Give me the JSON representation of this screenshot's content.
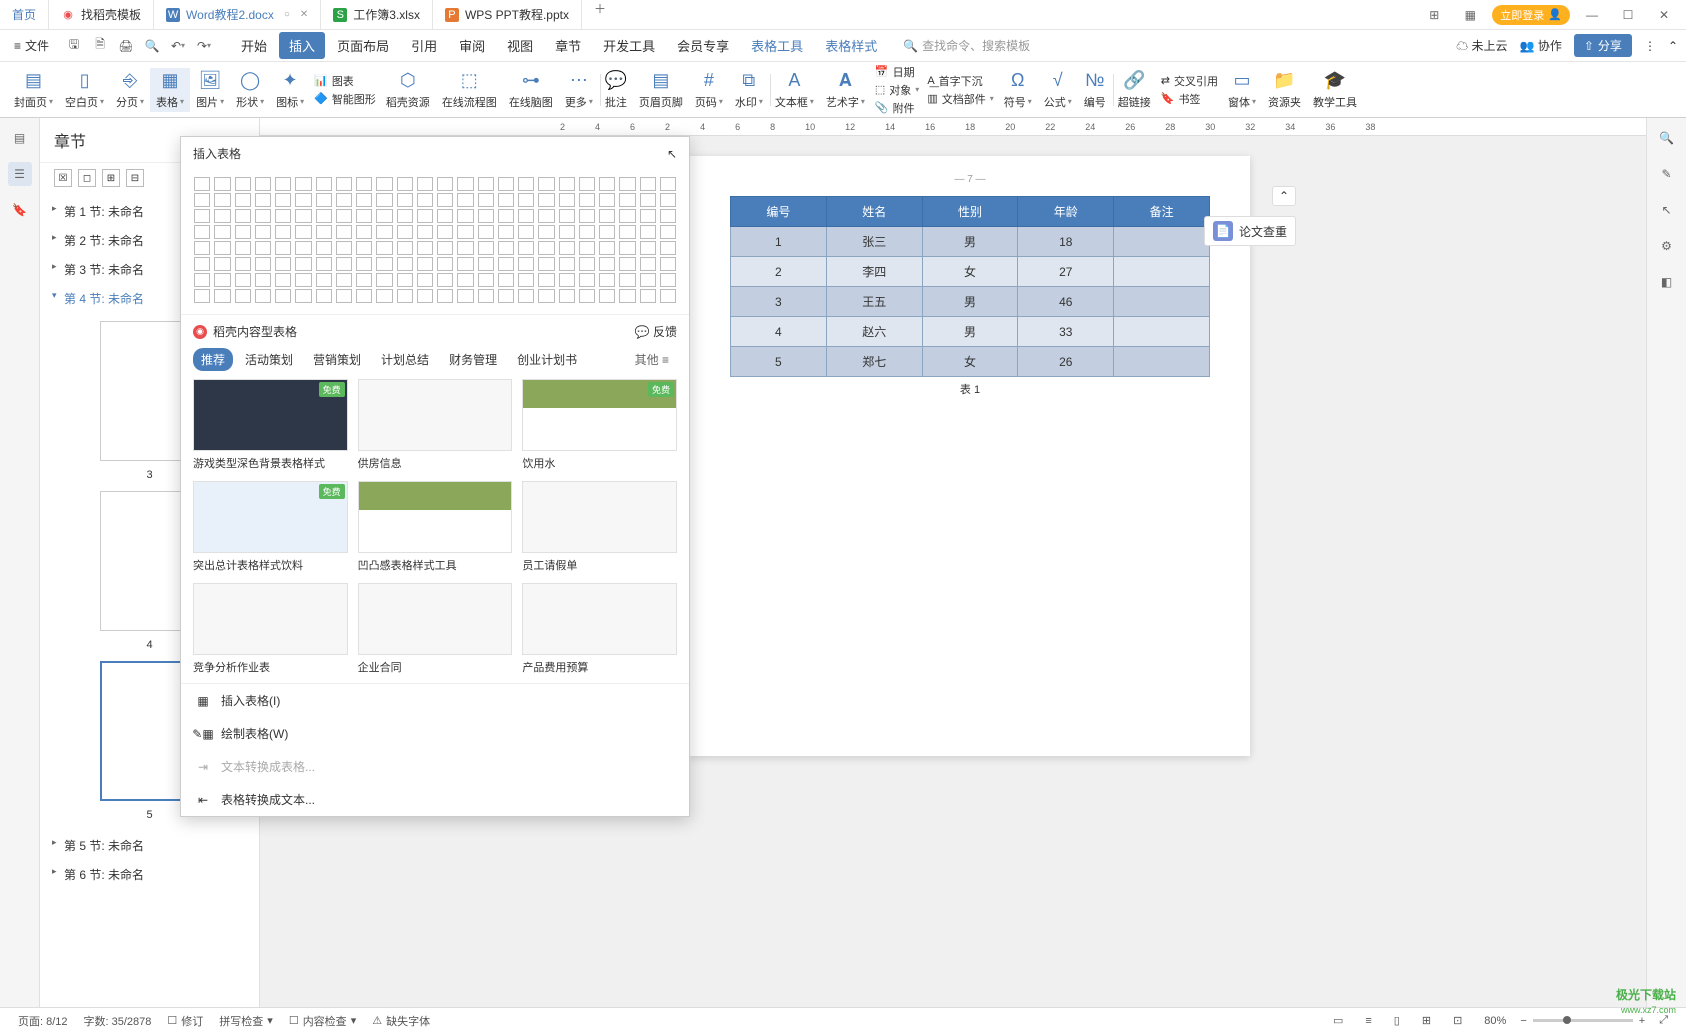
{
  "tabs": {
    "home": "首页",
    "t1": "找稻壳模板",
    "t2": "Word教程2.docx",
    "t3": "工作簿3.xlsx",
    "t4": "WPS PPT教程.pptx"
  },
  "titlebar": {
    "login": "立即登录"
  },
  "menubar": {
    "file": "文件",
    "tabs": [
      "开始",
      "插入",
      "页面布局",
      "引用",
      "审阅",
      "视图",
      "章节",
      "开发工具",
      "会员专享",
      "表格工具",
      "表格样式"
    ],
    "search_ph": "查找命令、搜索模板",
    "cloud": "未上云",
    "collab": "协作",
    "share": "分享"
  },
  "ribbon": {
    "cover": "封面页",
    "blank": "空白页",
    "pagebreak": "分页",
    "table": "表格",
    "pic": "图片",
    "shape": "形状",
    "icon": "图标",
    "chart": "图表",
    "smart": "智能图形",
    "docer": "稻壳资源",
    "flow": "在线流程图",
    "mind": "在线脑图",
    "more": "更多",
    "comment": "批注",
    "header": "页眉页脚",
    "pagen": "页码",
    "watermark": "水印",
    "textbox": "文本框",
    "wordart": "艺术字",
    "date": "日期",
    "object": "对象",
    "attach": "附件",
    "dropcap": "首字下沉",
    "docpart": "文档部件",
    "symbol": "符号",
    "formula": "公式",
    "number": "编号",
    "link": "超链接",
    "crossref": "交叉引用",
    "bookmark": "书签",
    "window": "窗体",
    "resource": "资源夹",
    "teach": "教学工具"
  },
  "sidebar": {
    "title": "章节",
    "chapters": [
      "第 1 节: 未命名",
      "第 2 节: 未命名",
      "第 3 节: 未命名",
      "第 4 节: 未命名",
      "第 5 节: 未命名",
      "第 6 节: 未命名"
    ],
    "thumb_nums": [
      "3",
      "4",
      "5"
    ]
  },
  "dropdown": {
    "title": "插入表格",
    "section_title": "稻壳内容型表格",
    "feedback": "反馈",
    "cat_tabs": [
      "推荐",
      "活动策划",
      "营销策划",
      "计划总结",
      "财务管理",
      "创业计划书"
    ],
    "other": "其他",
    "free": "免费",
    "templates_r1": [
      "游戏类型深色背景表格样式",
      "供房信息",
      "饮用水"
    ],
    "templates_r2": [
      "突出总计表格样式饮料",
      "凹凸感表格样式工具",
      "员工请假单"
    ],
    "templates_r3": [
      "竞争分析作业表",
      "企业合同",
      "产品费用预算"
    ],
    "menu": {
      "insert": "插入表格(I)",
      "draw": "绘制表格(W)",
      "t2t": "文本转换成表格...",
      "t2x": "表格转换成文本..."
    }
  },
  "ruler": [
    "2",
    "4",
    "6",
    "2",
    "4",
    "6",
    "8",
    "10",
    "12",
    "14",
    "16",
    "18",
    "20",
    "22",
    "24",
    "26",
    "28",
    "30",
    "32",
    "34",
    "36",
    "38"
  ],
  "page": {
    "num": "— 7 —",
    "headers": [
      "编号",
      "姓名",
      "性别",
      "年龄",
      "备注"
    ],
    "rows": [
      [
        "1",
        "张三",
        "男",
        "18",
        ""
      ],
      [
        "2",
        "李四",
        "女",
        "27",
        ""
      ],
      [
        "3",
        "王五",
        "男",
        "46",
        ""
      ],
      [
        "4",
        "赵六",
        "男",
        "33",
        ""
      ],
      [
        "5",
        "郑七",
        "女",
        "26",
        ""
      ]
    ],
    "caption": "表 1"
  },
  "chip": "论文查重",
  "statusbar": {
    "page": "页面: 8/12",
    "words": "字数: 35/2878",
    "rev": "修订",
    "spell": "拼写检查",
    "content": "内容检查",
    "font": "缺失字体",
    "zoom": "80%"
  },
  "watermark": {
    "main": "极光下载站",
    "sub": "www.xz7.com"
  }
}
